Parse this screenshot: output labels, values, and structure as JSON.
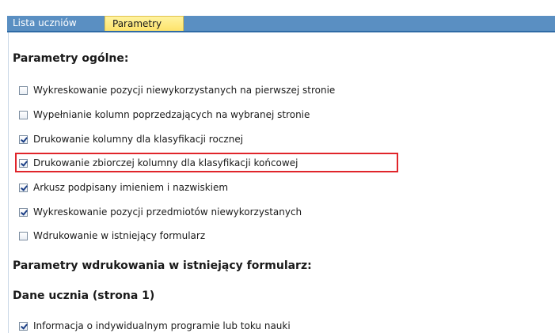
{
  "tabs": {
    "lista_label": "Lista uczniów",
    "parametry_label": "Parametry"
  },
  "general": {
    "title": "Parametry ogólne:",
    "options": [
      {
        "label": "Wykreskowanie pozycji niewykorzystanych na pierwszej stronie",
        "checked": false
      },
      {
        "label": "Wypełnianie kolumn poprzedzających na wybranej stronie",
        "checked": false
      },
      {
        "label": "Drukowanie kolumny dla klasyfikacji rocznej",
        "checked": true
      },
      {
        "label": "Drukowanie zbiorczej kolumny dla klasyfikacji końcowej",
        "checked": true
      },
      {
        "label": "Arkusz podpisany imieniem i nazwiskiem",
        "checked": true
      },
      {
        "label": "Wykreskowanie pozycji przedmiotów niewykorzystanych",
        "checked": true
      },
      {
        "label": "Wdrukowanie w istniejący formularz",
        "checked": false
      }
    ]
  },
  "print_params": {
    "title": "Parametry wdrukowania w istniejący formularz:"
  },
  "student": {
    "title": "Dane ucznia (strona 1)",
    "options": [
      {
        "label": "Informacja o indywidualnym programie lub toku nauki",
        "checked": true
      }
    ]
  },
  "colors": {
    "tab_blue": "#5a8fc2",
    "tab_active_yellow": "#fde36b",
    "highlight_red": "#e0252b"
  }
}
